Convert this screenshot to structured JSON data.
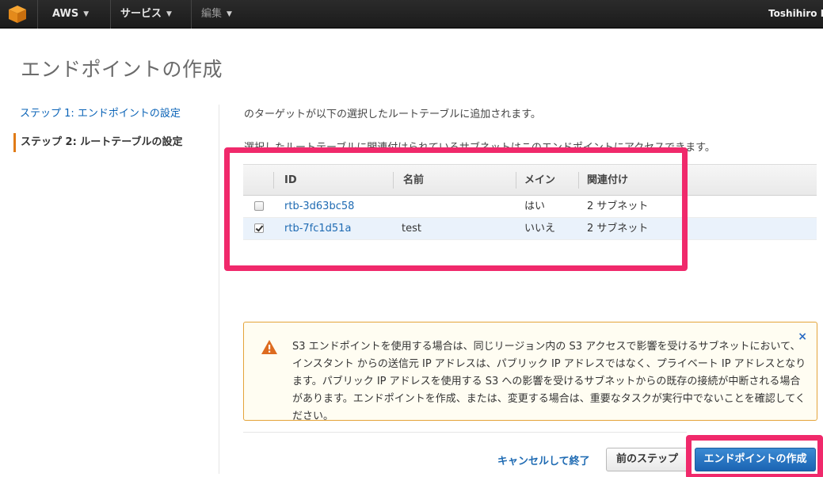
{
  "nav": {
    "aws_label": "AWS",
    "services_label": "サービス",
    "edit_label": "編集",
    "user_label": "Toshihiro K"
  },
  "page": {
    "title": "エンドポイントの作成"
  },
  "steps": {
    "step1_label": "ステップ 1: エンドポイントの設定",
    "step2_label": "ステップ 2: ルートテーブルの設定"
  },
  "description": {
    "line1": "のターゲットが以下の選択したルートテーブルに追加されます。",
    "line2": "選択したルートテーブルに関連付けられているサブネットはこのエンドポイントにアクセスできます。"
  },
  "route_table": {
    "headers": {
      "id": "ID",
      "name": "名前",
      "main": "メイン",
      "associated": "関連付け"
    },
    "rows": [
      {
        "checked": false,
        "id": "rtb-3d63bc58",
        "name": "",
        "main": "はい",
        "associated": "2 サブネット"
      },
      {
        "checked": true,
        "id": "rtb-7fc1d51a",
        "name": "test",
        "main": "いいえ",
        "associated": "2 サブネット"
      }
    ]
  },
  "alert": {
    "message": "S3 エンドポイントを使用する場合は、同じリージョン内の S3 アクセスで影響を受けるサブネットにおいて、インスタント からの送信元 IP アドレスは、パブリック IP アドレスではなく、プライベート IP アドレスとなります。パブリック IP アドレスを使用する S3 への影響を受けるサブネットからの既存の接続が中断される場合があります。エンドポイントを作成、または、変更する場合は、重要なタスクが実行中でないことを確認してください。",
    "close_glyph": "×"
  },
  "footer": {
    "cancel_label": "キャンセルして終了",
    "prev_label": "前のステップ",
    "create_label": "エンドポイントの作成"
  },
  "colors": {
    "nav_bg": "#1b1b1b",
    "link": "#1f6bb3",
    "highlight": "#f0296b",
    "primary_button": "#1b64b3",
    "active_step_bar": "#e07b17"
  }
}
